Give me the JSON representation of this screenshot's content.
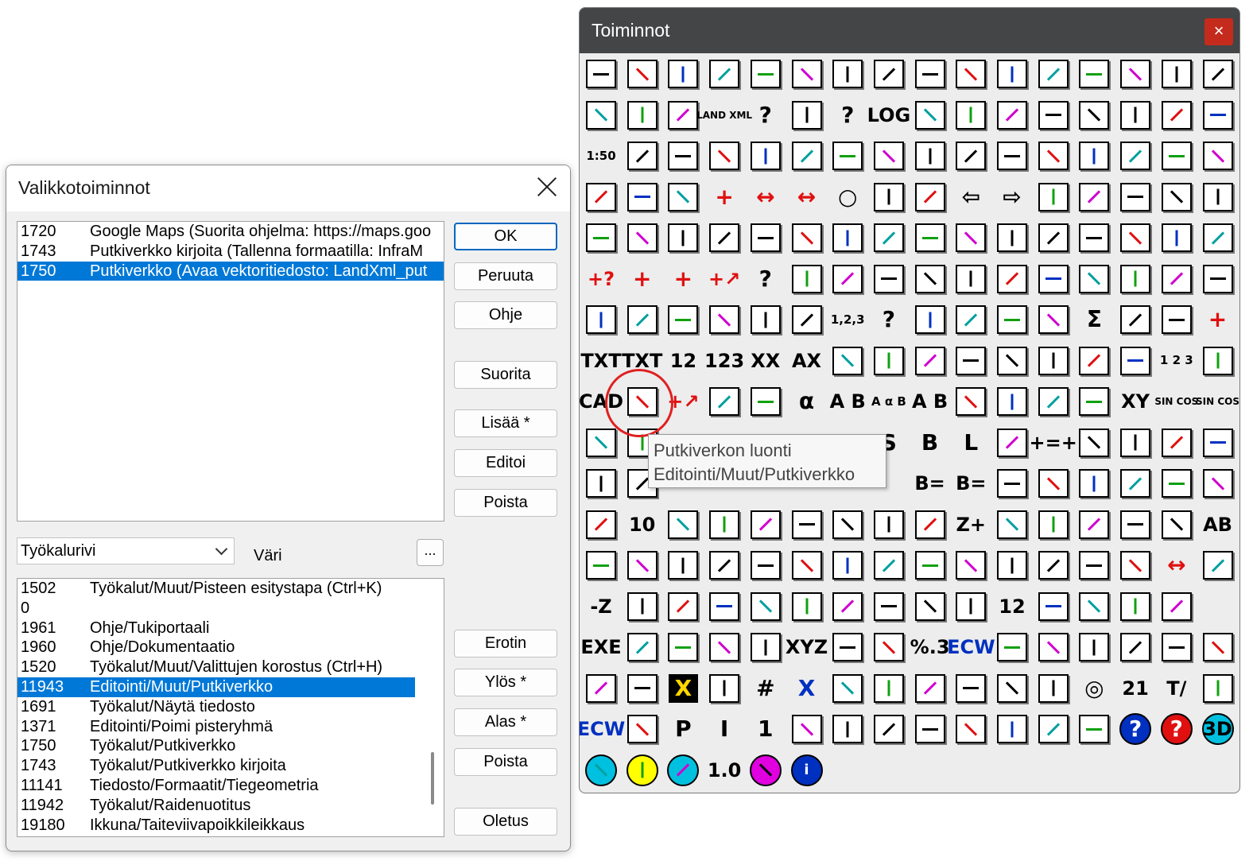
{
  "dialog": {
    "title": "Valikkotoiminnot",
    "menu_list": [
      {
        "id": "1720",
        "text": "Google Maps (Suorita ohjelma: https://maps.goo"
      },
      {
        "id": "1743",
        "text": "Putkiverkko kirjoita (Tallenna formaatilla: InfraM"
      },
      {
        "id": "1750",
        "text": "Putkiverkko (Avaa vektoritiedosto: LandXml_put"
      }
    ],
    "menu_selected_index": 2,
    "toolbar_select": "Työkalurivi",
    "color_label": "Väri",
    "dots_button": "...",
    "command_list": [
      {
        "id": "1502",
        "text": "Työkalut/Muut/Pisteen esitystapa (Ctrl+K)"
      },
      {
        "id": "0",
        "text": ""
      },
      {
        "id": "1961",
        "text": "Ohje/Tukiportaali"
      },
      {
        "id": "1960",
        "text": "Ohje/Dokumentaatio"
      },
      {
        "id": "1520",
        "text": "Työkalut/Muut/Valittujen korostus (Ctrl+H)"
      },
      {
        "id": "11943",
        "text": "Editointi/Muut/Putkiverkko"
      },
      {
        "id": "1691",
        "text": "Työkalut/Näytä tiedosto"
      },
      {
        "id": "1371",
        "text": "Editointi/Poimi pisteryhmä"
      },
      {
        "id": "1750",
        "text": "Työkalut/Putkiverkko"
      },
      {
        "id": "1743",
        "text": "Työkalut/Putkiverkko kirjoita"
      },
      {
        "id": "11141",
        "text": "Tiedosto/Formaatit/Tiegeometria"
      },
      {
        "id": "11942",
        "text": "Työkalut/Raidenuotitus"
      },
      {
        "id": "19180",
        "text": "Ikkuna/Taiteviivapoikkileikkaus"
      }
    ],
    "command_selected_index": 5,
    "buttons": {
      "ok": "OK",
      "cancel": "Peruuta",
      "help": "Ohje",
      "run": "Suorita",
      "add": "Lisää *",
      "edit": "Editoi",
      "delete1": "Poista",
      "separator": "Erotin",
      "up": "Ylös *",
      "down": "Alas *",
      "delete2": "Poista",
      "default": "Oletus"
    }
  },
  "toolbox": {
    "title": "Toiminnot",
    "close_label": "×",
    "tooltip_line1": "Putkiverkon luonti",
    "tooltip_line2": "Editointi/Muut/Putkiverkko",
    "rows": [
      [
        "new-file",
        "new-file-2",
        "cad",
        "xml",
        "add-point",
        "file-plus",
        "file-arrow",
        "file-arrow-2",
        "file-red",
        "file-dup",
        "file-out",
        "file-out-2",
        "file-out-3",
        "file-alert",
        "hatch",
        "green-flag"
      ],
      [
        "people",
        "road",
        "polygon",
        "LAND XML",
        "?",
        "doc-red",
        "?",
        "LOG",
        "docs",
        "doc-x",
        "doc-q",
        "arrows",
        "docs-red",
        "hatch-2",
        "doc-stack",
        "printer"
      ],
      [
        "1:50",
        "frame",
        "fullscreen",
        "corner",
        "window-dash",
        "window",
        "walker",
        "page",
        "page-2",
        "pages",
        "doc-lines",
        "doc-lines-2",
        "flow",
        "flow-2",
        "hatch-red",
        "triangle-cyan"
      ],
      [
        "hatch-blue",
        "monitor",
        "arrow-diag",
        "+",
        "↔",
        "↔",
        "○",
        "page",
        "fit",
        "⇦",
        "⇨",
        "moon",
        "zoom-in",
        "zoom-out",
        "copy",
        "screen-diag"
      ],
      [
        "frame-2",
        "grid-3d",
        "slash",
        "sphere",
        "shade",
        "slash-g",
        "slash-g2",
        "box-arrow",
        "monitor-2",
        "undo",
        "redo",
        "scissors",
        "mirror",
        "clipboard",
        "txt-plus",
        "txt-cyan"
      ],
      [
        "+?",
        "+",
        "+",
        "+↗",
        "?",
        "bend",
        "bend-2",
        "curve",
        "check",
        "shape-red",
        "curve-2",
        "circle-red",
        "lines",
        "pencil",
        "zig",
        "curve-3"
      ],
      [
        "box-3d",
        "wrench",
        "magenta",
        "tri",
        "sphere-g",
        "disc-g",
        "1,2,3",
        "?",
        "grid",
        "grid-2",
        "grid-3",
        "grid-4",
        "Σ",
        "lines-2",
        "grid-5",
        "+"
      ],
      [
        "TXT",
        "TXT",
        "12",
        "123",
        "XX",
        "AX",
        "line-g",
        "hatch",
        "hatch",
        "doc-plus",
        "dots",
        "hatch-blue",
        "hatch",
        "curve-cyan",
        "1 2 3",
        "slash-g3"
      ],
      [
        "CAD",
        "network",
        "+↗",
        "ruler",
        "rect",
        "α",
        "A B",
        "A α B",
        "A B",
        "m²",
        "circle-x",
        "circle-red",
        "eye",
        "XY",
        "SIN COS",
        "SIN COS"
      ],
      [
        "xy",
        "arrow",
        "",
        "",
        "",
        "",
        "",
        "S",
        "B",
        "L",
        "ruler-red",
        "+=+",
        "axis",
        "axis-2",
        "axis-3",
        "axis-4"
      ],
      [
        "doc-axis",
        "plot",
        "",
        "",
        "",
        "",
        "",
        "",
        "B=",
        "B=",
        "tri-net",
        "tri-net-2",
        "tri-net-3",
        "tri-net-4",
        "tri-net-5",
        "tri-net-6"
      ],
      [
        "contour",
        "10",
        "plus-line",
        "slope",
        "wave",
        "wave-2",
        "net",
        "cube-g",
        "m³",
        "Z+",
        "poly-red",
        "poly-y",
        "tri-red",
        "wrench-2",
        "xy-g",
        "AB"
      ],
      [
        "axis-red",
        "net-2",
        "net-3",
        "net-4",
        "net-5",
        "frame-3",
        "frame-4",
        "trees",
        "curve-r",
        "curve-y",
        "curve-y2",
        "curve-r2",
        "curves",
        "curve-y3",
        "↔",
        "curve-y4"
      ],
      [
        "-Z",
        "parallel",
        "road-2",
        "net-6",
        "tower",
        "frame-5",
        "tower-2",
        "tower-3",
        "tower-4",
        "tower-5",
        "12",
        "frame-6",
        "rect-2",
        "frame-7",
        "frame-8",
        ""
      ],
      [
        "EXE",
        "window-2",
        "screen",
        "key",
        "arrow-x",
        "XYZ",
        "slash-doc",
        "doc-3",
        "%.3",
        "ECW",
        "grid-6",
        "globe",
        "globe-2",
        "globe-3",
        "globe-4",
        "globe-5"
      ],
      [
        "globe-6",
        "globe-7",
        "X",
        "red-grid",
        "#",
        "X",
        "wrench-3",
        "jar",
        "grid-7",
        "grid-8",
        "list",
        "check-red",
        "◎",
        "21",
        "T/",
        "hatch-3"
      ],
      [
        "ECW",
        "survey",
        "P",
        "I",
        "1",
        "chart",
        "chart-2",
        "chart-3",
        "chart-4",
        "chart-5",
        "chart-6",
        "square-g",
        "square-g2",
        "?",
        "?",
        "3D"
      ],
      [
        "headset",
        "page-y",
        "board",
        "1.0",
        "pin",
        "i"
      ]
    ]
  }
}
